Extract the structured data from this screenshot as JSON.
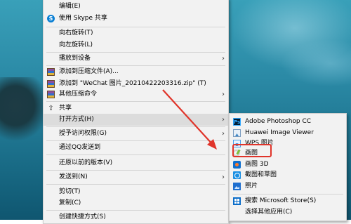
{
  "main_menu": {
    "items": [
      {
        "label": "编辑(E)"
      },
      {
        "label": "使用 Skype 共享",
        "icon": "skype-icon"
      },
      {
        "label": "向右旋转(T)"
      },
      {
        "label": "向左旋转(L)"
      },
      {
        "label": "播放到设备",
        "submenu": true
      },
      {
        "label": "添加到压缩文件(A)...",
        "icon": "archive-icon"
      },
      {
        "label": "添加到 \"WeChat 图片_20210422203316.zip\" (T)",
        "icon": "archive-icon"
      },
      {
        "label": "其他压缩命令",
        "icon": "archive-icon",
        "submenu": true
      },
      {
        "label": "共享",
        "icon": "share-icon"
      },
      {
        "label": "打开方式(H)",
        "submenu": true
      },
      {
        "label": "授予访问权限(G)",
        "submenu": true
      },
      {
        "label": "通过QQ发送到"
      },
      {
        "label": "还原以前的版本(V)"
      },
      {
        "label": "发送到(N)",
        "submenu": true
      },
      {
        "label": "剪切(T)"
      },
      {
        "label": "复制(C)"
      },
      {
        "label": "创建快捷方式(S)"
      }
    ]
  },
  "submenu_arrow": "›",
  "open_with_menu": {
    "items": [
      {
        "label": "Adobe Photoshop CC",
        "icon": "photoshop-icon"
      },
      {
        "label": "Huawei Image Viewer",
        "icon": "image-viewer-icon"
      },
      {
        "label": "WPS 图片",
        "icon": "wps-picture-icon"
      },
      {
        "label": "画图",
        "icon": "paint-icon"
      },
      {
        "label": "画图 3D",
        "icon": "paint-3d-icon"
      },
      {
        "label": "截图和草图",
        "icon": "snip-sketch-icon"
      },
      {
        "label": "照片",
        "icon": "photos-icon"
      },
      {
        "label": "搜索 Microsoft Store(S)",
        "icon": "store-icon"
      },
      {
        "label": "选择其他应用(C)"
      }
    ]
  },
  "icon_glyphs": {
    "skype": "S",
    "photoshop": "Ps",
    "share": "⇪"
  },
  "colors": {
    "highlight": "#e0342a",
    "menu_bg": "#f2f2f2",
    "hover": "#dcdcdc"
  }
}
